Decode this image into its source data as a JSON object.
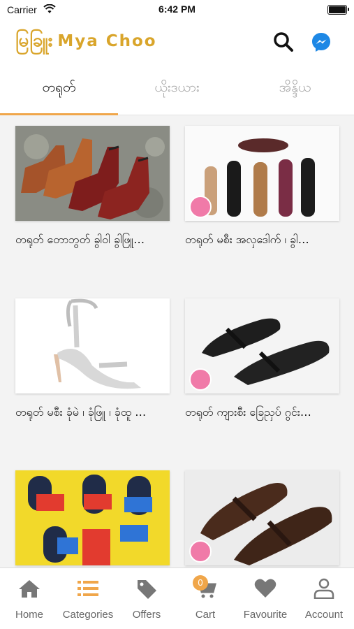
{
  "status_bar": {
    "carrier": "Carrier",
    "time": "6:42 PM"
  },
  "header": {
    "logo_myanmar": "မြခြူး",
    "logo_latin": "Mya Choo"
  },
  "tabs": [
    {
      "label": "တရုတ်"
    },
    {
      "label": "ယိုးဒယား"
    },
    {
      "label": "အိန္ဒိယ"
    }
  ],
  "products": [
    {
      "caption": "တရုတ် တောဘွတ် ခွါဝါ ခွါဖြူ…"
    },
    {
      "caption": "တရုတ် မစီး အလှဒေါက် ၊ ခွါ…"
    },
    {
      "caption": "တရုတ် မစီး ခုံမဲ ၊ ခုံဖြူ ၊ ခုံထူ …"
    },
    {
      "caption": "တရုတ် ကျားစီး ခြေညှပ် ဂွင်း…"
    },
    {
      "caption": ""
    },
    {
      "caption": ""
    }
  ],
  "bottom_nav": [
    {
      "label": "Home"
    },
    {
      "label": "Categories"
    },
    {
      "label": "Offers"
    },
    {
      "label": "Cart",
      "badge": "0"
    },
    {
      "label": "Favourite"
    },
    {
      "label": "Account"
    }
  ],
  "colors": {
    "accent": "#f0a64a",
    "brand": "#d9a52b",
    "messenger": "#1e88e5"
  }
}
